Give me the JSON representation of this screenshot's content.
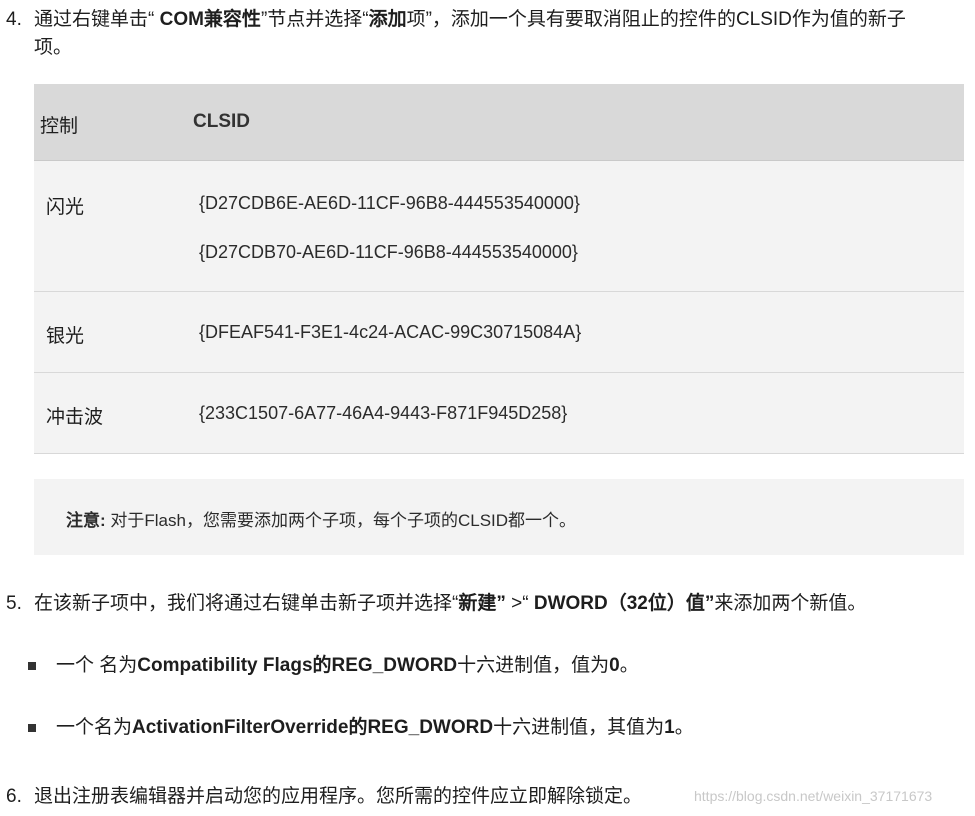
{
  "steps": {
    "s4": {
      "num": "4.",
      "line1_a": "通过右键单击“ ",
      "line1_b": "COM兼容性",
      "line1_c": "”节点并选择“",
      "line1_d": "添加",
      "line1_e": "项”，添加一个具有要取消阻止的控件的CLSID作为值的新子",
      "line2": "项。"
    },
    "s5": {
      "num": "5.",
      "a": "在该新子项中，我们将通过右键单击新子项并选择“",
      "b": "新建”",
      "c": " >“ ",
      "d": "DWORD（32位）值”",
      "e": "来添加两个新值。"
    },
    "s6": {
      "num": "6.",
      "text": "退出注册表编辑器并启动您的应用程序。您所需的控件应立即解除锁定。"
    }
  },
  "table": {
    "header_control": "控制",
    "header_clsid": "CLSID",
    "rows": [
      {
        "control": "闪光",
        "clsid1": "{D27CDB6E-AE6D-11CF-96B8-444553540000}",
        "clsid2": "{D27CDB70-AE6D-11CF-96B8-444553540000}"
      },
      {
        "control": "银光",
        "clsid1": "{DFEAF541-F3E1-4c24-ACAC-99C30715084A}"
      },
      {
        "control": "冲击波",
        "clsid1": "{233C1507-6A77-46A4-9443-F871F945D258}"
      }
    ]
  },
  "note": {
    "label": "注意:",
    "text": " 对于Flash，您需要添加两个子项，每个子项的CLSID都一个。"
  },
  "bullets": [
    {
      "a": "一个 名为",
      "b": "Compatibility Flags的REG_DWORD",
      "c": "十六进制值，值为",
      "d": "0",
      "e": "。"
    },
    {
      "a": "一个名为",
      "b": "ActivationFilterOverride的REG_DWORD",
      "c": "十六进制值，其值为",
      "d": "1",
      "e": "。"
    }
  ],
  "watermark": "https://blog.csdn.net/weixin_37171673"
}
